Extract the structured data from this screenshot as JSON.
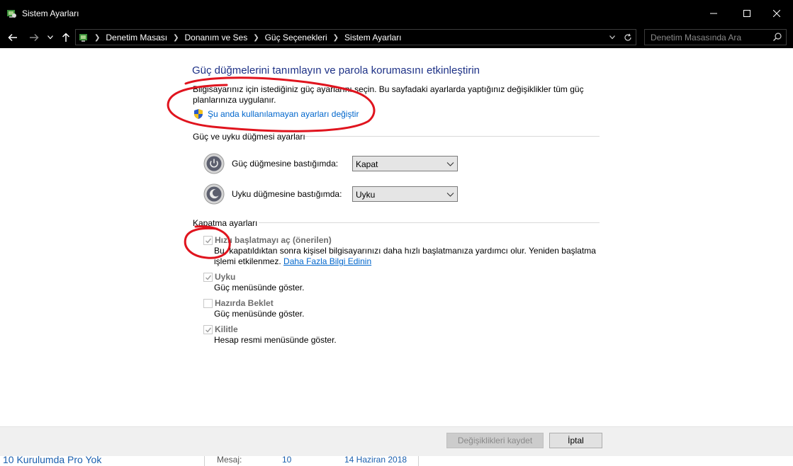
{
  "window": {
    "title": "Sistem Ayarları"
  },
  "address_bar": {
    "breadcrumbs": [
      "Denetim Masası",
      "Donanım ve Ses",
      "Güç Seçenekleri",
      "Sistem Ayarları"
    ]
  },
  "search": {
    "placeholder": "Denetim Masasında Ara"
  },
  "page": {
    "heading": "Güç düğmelerini tanımlayın ve parola korumasını etkinleştirin",
    "intro": "Bilgisayarınız için istediğiniz güç ayarlarını seçin. Bu sayfadaki ayarlarda yaptığınız değişiklikler tüm güç planlarınıza uygulanır.",
    "change_settings_link": "Şu anda kullanılamayan ayarları değiştir"
  },
  "power_buttons": {
    "section_label": "Güç ve uyku düğmesi ayarları",
    "rows": [
      {
        "label": "Güç düğmesine bastığımda:",
        "value": "Kapat",
        "icon": "power-button-icon"
      },
      {
        "label": "Uyku düğmesine bastığımda:",
        "value": "Uyku",
        "icon": "sleep-button-icon"
      }
    ]
  },
  "shutdown": {
    "section_label": "Kapatma ayarları",
    "options": [
      {
        "name": "Hızlı başlatmayı aç (önerilen)",
        "checked": true,
        "desc": "Bu, kapatıldıktan sonra kişisel bilgisayarınızı daha hızlı başlatmanıza yardımcı olur. Yeniden başlatma işlemi etkilenmez.",
        "link": "Daha Fazla Bilgi Edinin"
      },
      {
        "name": "Uyku",
        "checked": true,
        "desc": "Güç menüsünde göster."
      },
      {
        "name": "Hazırda Beklet",
        "checked": false,
        "desc": "Güç menüsünde göster."
      },
      {
        "name": "Kilitle",
        "checked": true,
        "desc": "Hesap resmi menüsünde göster."
      }
    ]
  },
  "footer": {
    "save_label": "Değişiklikleri kaydet",
    "cancel_label": "İptal"
  },
  "background_window": {
    "row_title": "10 Kurulumda Pro Yok",
    "label": "Mesaj:",
    "count": "10",
    "date": "14 Haziran 2018"
  },
  "colors": {
    "heading": "#1e3287",
    "link": "#0066cc",
    "annotation": "#e0141e"
  }
}
